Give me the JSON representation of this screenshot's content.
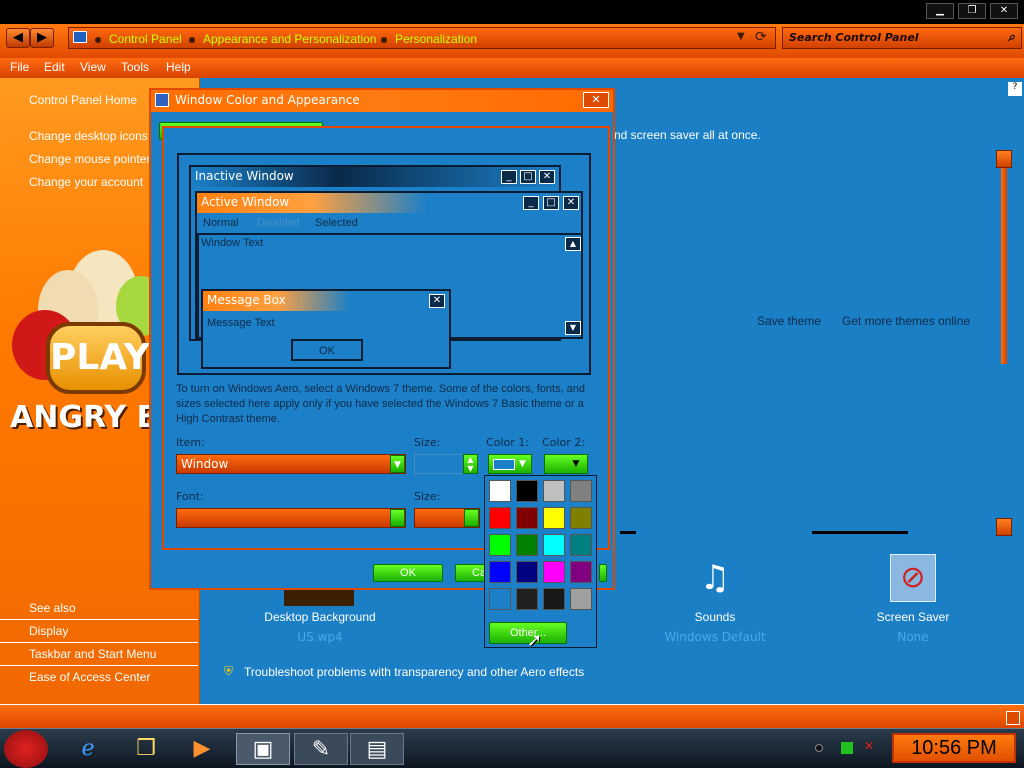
{
  "titlebar": {
    "minimize": "▁",
    "maximize": "❐",
    "close": "✕"
  },
  "address": {
    "crumbs": [
      "Control Panel",
      "Appearance and Personalization",
      "Personalization"
    ],
    "search_placeholder": "Search Control Panel"
  },
  "menu": [
    "File",
    "Edit",
    "View",
    "Tools",
    "Help"
  ],
  "sidebar": {
    "home": "Control Panel Home",
    "links": [
      "Change desktop icons",
      "Change mouse pointers",
      "Change your account"
    ],
    "see_also": "See also",
    "see_links": [
      "Display",
      "Taskbar and Start Menu",
      "Ease of Access Center"
    ],
    "ad_text": "PLAY",
    "ad_brand": "ANGRY BIRDS"
  },
  "main": {
    "intro": "nd screen saver all at once.",
    "save_theme": "Save theme",
    "more_themes": "Get more themes online",
    "themes": [
      {
        "label": "Desktop Background",
        "sub": "US.wp4"
      },
      {
        "label": "Sounds",
        "sub": "Windows Default"
      },
      {
        "label": "Screen Saver",
        "sub": "None"
      }
    ],
    "troubleshoot": "Troubleshoot problems with transparency and other Aero effects"
  },
  "dialog": {
    "title": "Window Color and Appearance",
    "tab": "Window Color and Appearance",
    "preview": {
      "inactive": "Inactive Window",
      "active": "Active Window",
      "menu_normal": "Normal",
      "menu_disabled": "Disabled",
      "menu_selected": "Selected",
      "window_text": "Window Text",
      "msgbox_title": "Message Box",
      "msgbox_text": "Message Text",
      "ok": "OK"
    },
    "info": "To turn on Windows Aero, select a Windows 7 theme.  Some of the colors, fonts, and sizes selected here apply only if you have selected the Windows 7 Basic theme or a High Contrast theme.",
    "item_label": "Item:",
    "item_value": "Window",
    "size_label": "Size:",
    "color1_label": "Color 1:",
    "color2_label": "Color 2:",
    "font_label": "Font:",
    "font_size_label": "Size:",
    "ok": "OK",
    "cancel": "Ca",
    "other": "Other..."
  },
  "palette": [
    "#ffffff",
    "#000000",
    "#c0c0c0",
    "#808080",
    "#ff0000",
    "#800000",
    "#ffff00",
    "#808000",
    "#00ff00",
    "#008000",
    "#00ffff",
    "#008080",
    "#0000ff",
    "#000080",
    "#ff00ff",
    "#800080",
    "#1b80c8",
    "#202020",
    "#181818",
    "#a0a0a0"
  ],
  "taskbar": {
    "time": "10:56 PM"
  }
}
